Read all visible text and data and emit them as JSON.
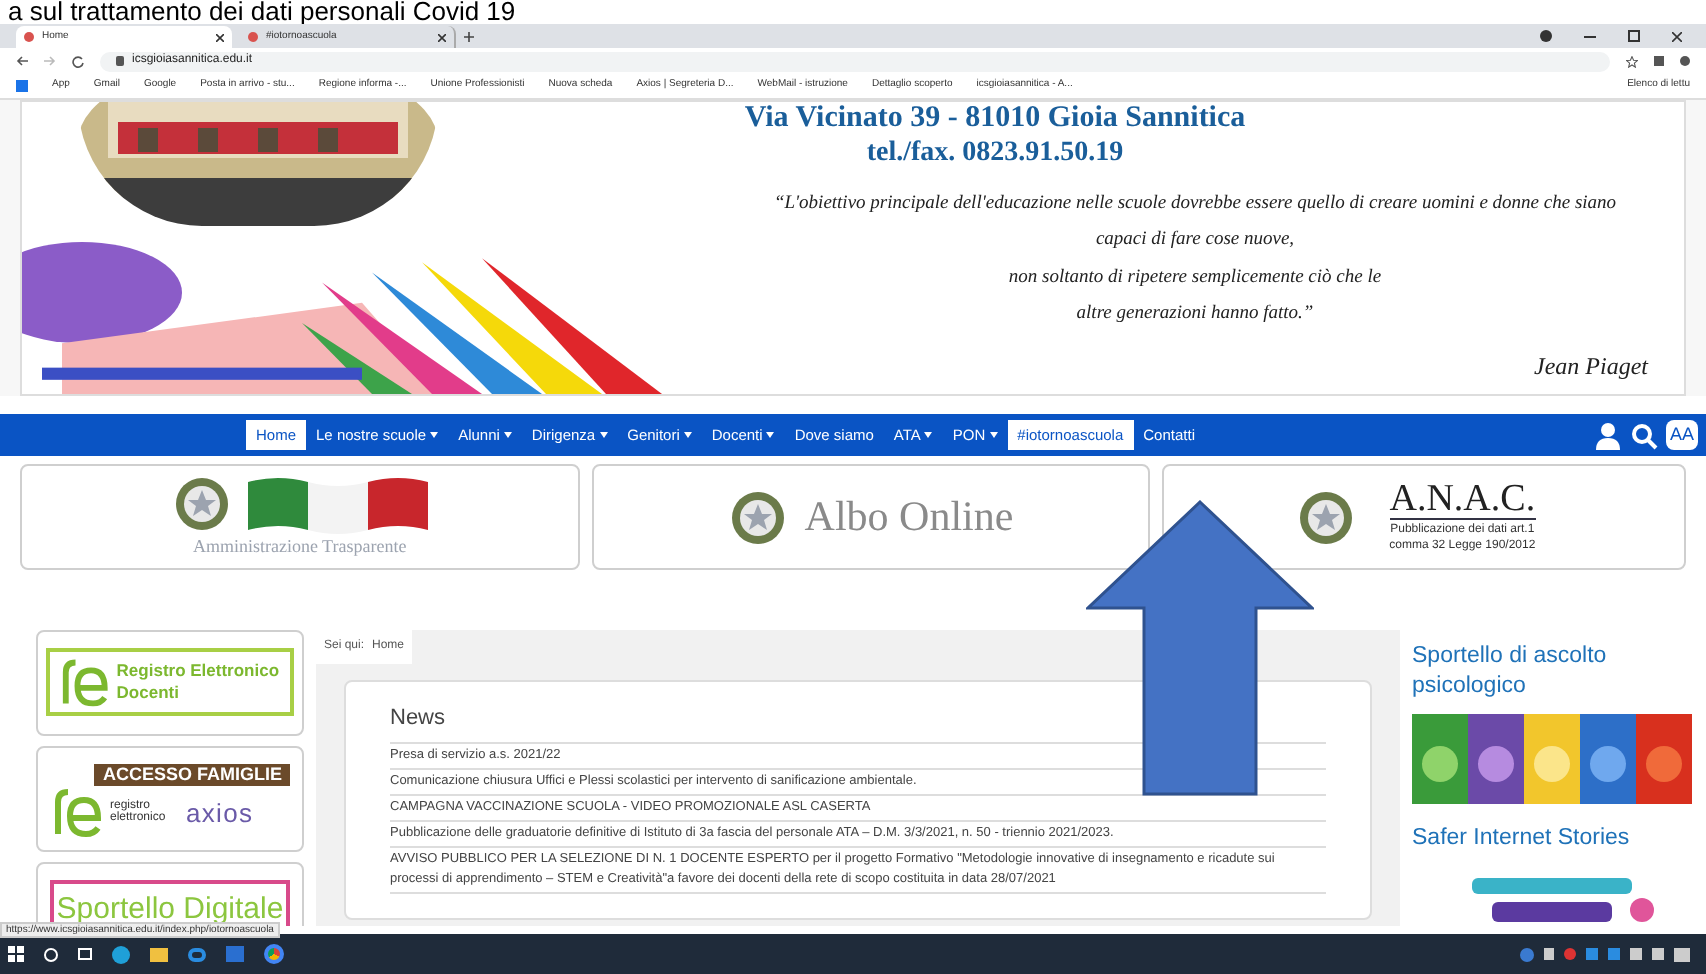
{
  "caption": "a sul trattamento dei dati personali Covid 19",
  "browser": {
    "tabs": [
      {
        "label": "Home",
        "selected": true
      },
      {
        "label": "#iotornoascuola",
        "selected": false
      }
    ],
    "url": "icsgioiasannitica.edu.it",
    "bookmarks": [
      "App",
      "Gmail",
      "Google",
      "Posta in arrivo - stu...",
      "Regione informa -...",
      "Unione Professionisti",
      "Nuova scheda",
      "Axios | Segreteria D...",
      "WebMail - istruzione",
      "Dettaglio scoperto",
      "icsgioiasannitica - A..."
    ],
    "reading_list": "Elenco di lettu"
  },
  "header": {
    "address": "Via Vicinato 39 - 81010 Gioia Sannitica",
    "phone": "tel./fax. 0823.91.50.19",
    "quote_lines": [
      "“L'obiettivo principale dell'educazione nelle scuole dovrebbe essere quello di creare uomini e donne che siano",
      "capaci di fare cose nuove,",
      "non soltanto di ripetere semplicemente ciò che le",
      "altre generazioni hanno fatto.”"
    ],
    "author": "Jean Piaget"
  },
  "nav": {
    "items": [
      {
        "label": "Home",
        "highlighted": true,
        "dropdown": false
      },
      {
        "label": "Le nostre scuole",
        "highlighted": false,
        "dropdown": true
      },
      {
        "label": "Alunni",
        "highlighted": false,
        "dropdown": true
      },
      {
        "label": "Dirigenza",
        "highlighted": false,
        "dropdown": true
      },
      {
        "label": "Genitori",
        "highlighted": false,
        "dropdown": true
      },
      {
        "label": "Docenti",
        "highlighted": false,
        "dropdown": true
      },
      {
        "label": "Dove siamo",
        "highlighted": false,
        "dropdown": false
      },
      {
        "label": "ATA",
        "highlighted": false,
        "dropdown": true
      },
      {
        "label": "PON",
        "highlighted": false,
        "dropdown": true
      },
      {
        "label": "#iotornoascuola",
        "highlighted": true,
        "dropdown": false
      },
      {
        "label": "Contatti",
        "highlighted": false,
        "dropdown": false
      }
    ],
    "font_button": "AA"
  },
  "banners": [
    {
      "kind": "flag",
      "title": "Amministrazione Trasparente"
    },
    {
      "kind": "albo",
      "title": "Albo Online"
    },
    {
      "kind": "anac",
      "title": "A.N.A.C.",
      "subtitle": "Pubblicazione dei dati art.1 comma 32 Legge 190/2012"
    }
  ],
  "sidebar": [
    {
      "kind": "registro",
      "title": "Registro Elettronico Docenti"
    },
    {
      "kind": "famiglie",
      "title": "ACCESSO FAMIGLIE",
      "subtitle": "registro elettronico",
      "brand": "axios"
    },
    {
      "kind": "sportello",
      "title": "Sportello Digitale"
    }
  ],
  "breadcrumb": {
    "label": "Sei qui:",
    "current": "Home"
  },
  "news": {
    "title": "News",
    "items": [
      "Presa di servizio a.s. 2021/22",
      "Comunicazione chiusura Uffici e Plessi scolastici per intervento di sanificazione ambientale.",
      "CAMPAGNA VACCINAZIONE SCUOLA - VIDEO PROMOZIONALE ASL CASERTA",
      "Pubblicazione delle graduatorie definitive di Istituto di 3a fascia del personale ATA – D.M. 3/3/2021, n. 50 - triennio 2021/2023.",
      "AVVISO PUBBLICO PER LA SELEZIONE DI N. 1 DOCENTE ESPERTO per il progetto Formativo \"Metodologie innovative di insegnamento e ricadute sui processi di apprendimento – STEM e Creatività\"a favore dei docenti della rete di scopo costituita in data 28/07/2021"
    ]
  },
  "right_column": [
    {
      "title": "Sportello di ascolto psicologico"
    },
    {
      "title": "Safer Internet Stories"
    }
  ],
  "status_url": "https://www.icsgioiasannitica.edu.it/index.php/iotornoascuola"
}
